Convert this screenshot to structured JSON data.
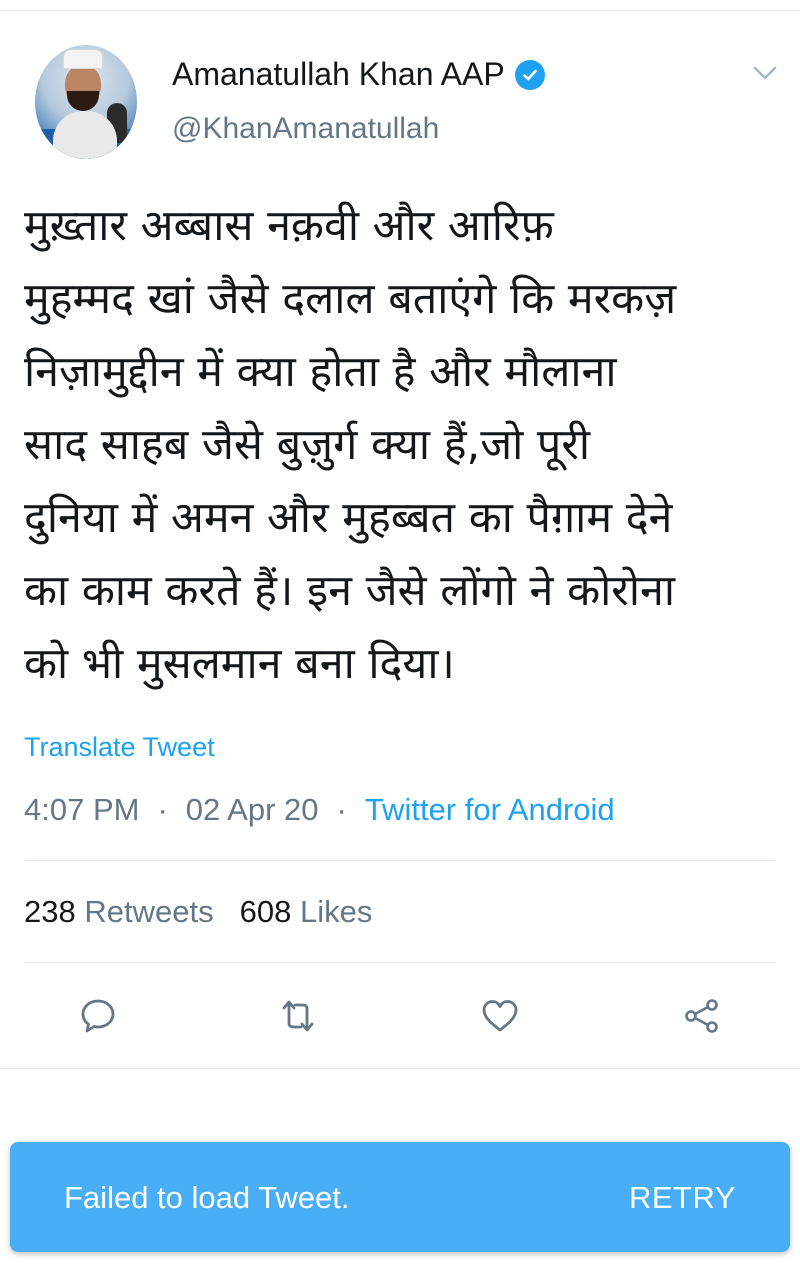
{
  "tweet": {
    "author": {
      "display_name": "Amanatullah Khan AAP",
      "handle": "@KhanAmanatullah",
      "verified": true
    },
    "text_lines": [
      "मुख़्तार अब्बास नक़वी और आरिफ़",
      "मुहम्मद खां जैसे दलाल बताएंगे कि मरकज़",
      "निज़ामुद्दीन में क्या होता है और मौलाना",
      "साद साहब जैसे बुज़ुर्ग क्या हैं,जो पूरी",
      "दुनिया में अमन और मुहब्बत का पैग़ाम देने",
      "का काम करते हैं। इन जैसे लोंगो ने कोरोना",
      "को भी मुसलमान बना दिया।"
    ],
    "translate_label": "Translate Tweet",
    "meta": {
      "time": "4:07 PM",
      "date": "02 Apr 20",
      "separator": "·",
      "source": "Twitter for Android"
    },
    "stats": {
      "retweets_count": "238",
      "retweets_label": "Retweets",
      "likes_count": "608",
      "likes_label": "Likes"
    },
    "actions": [
      "reply-icon",
      "retweet-icon",
      "like-icon",
      "share-icon"
    ]
  },
  "toast": {
    "message": "Failed to load Tweet.",
    "action_label": "RETRY"
  },
  "colors": {
    "link": "#1da1f2",
    "secondary_text": "#657786",
    "toast_bg": "#4aaef7"
  }
}
